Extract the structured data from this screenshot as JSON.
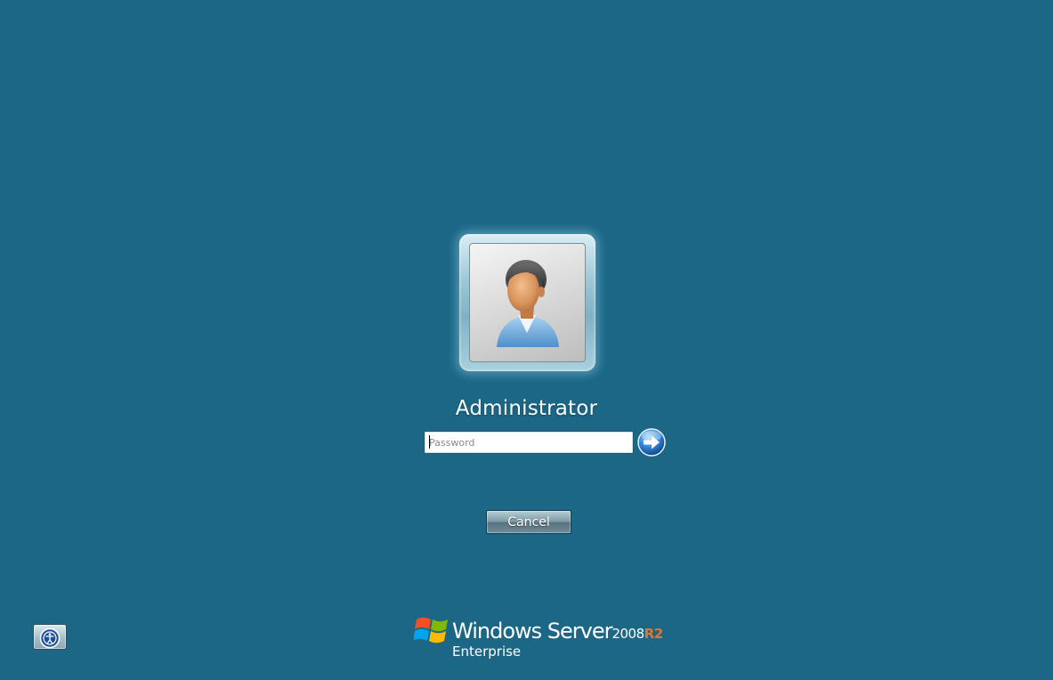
{
  "user": {
    "name": "Administrator",
    "avatar_icon": "user-avatar-icon"
  },
  "password": {
    "placeholder": "Password",
    "value": ""
  },
  "submit": {
    "icon": "arrow-right-icon"
  },
  "cancel": {
    "label": "Cancel"
  },
  "ease_of_access": {
    "icon": "ease-of-access-icon"
  },
  "branding": {
    "product": "Windows Server",
    "version": "2008",
    "release": "R2",
    "edition": "Enterprise",
    "logo_icon": "windows-flag-icon"
  },
  "colors": {
    "background": "#1c6786",
    "release_accent": "#e8742c",
    "text": "#ffffff"
  }
}
